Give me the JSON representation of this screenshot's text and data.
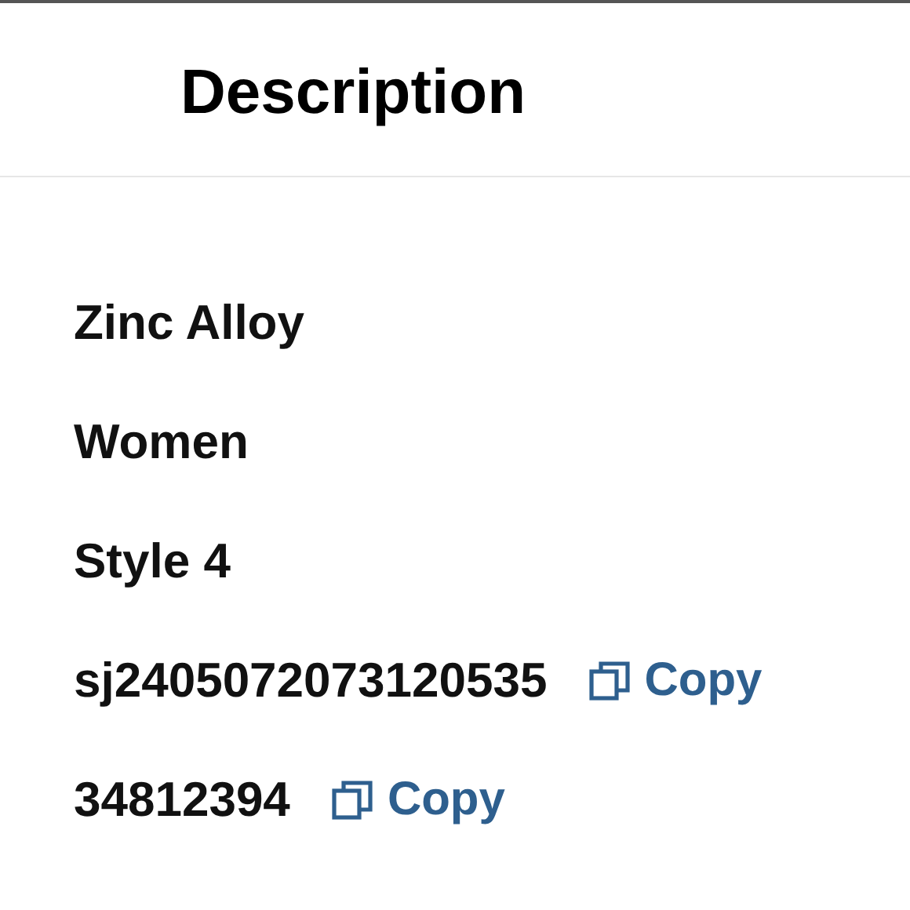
{
  "header": {
    "title": "Description"
  },
  "rows": [
    {
      "kind": "plain",
      "text": "Zinc Alloy"
    },
    {
      "kind": "plain",
      "text": "Women"
    },
    {
      "kind": "plain",
      "text": "Style 4"
    },
    {
      "kind": "copyable",
      "text": "sj2405072073120535",
      "action": "Copy"
    },
    {
      "kind": "copyable",
      "text": "34812394",
      "action": "Copy"
    }
  ]
}
